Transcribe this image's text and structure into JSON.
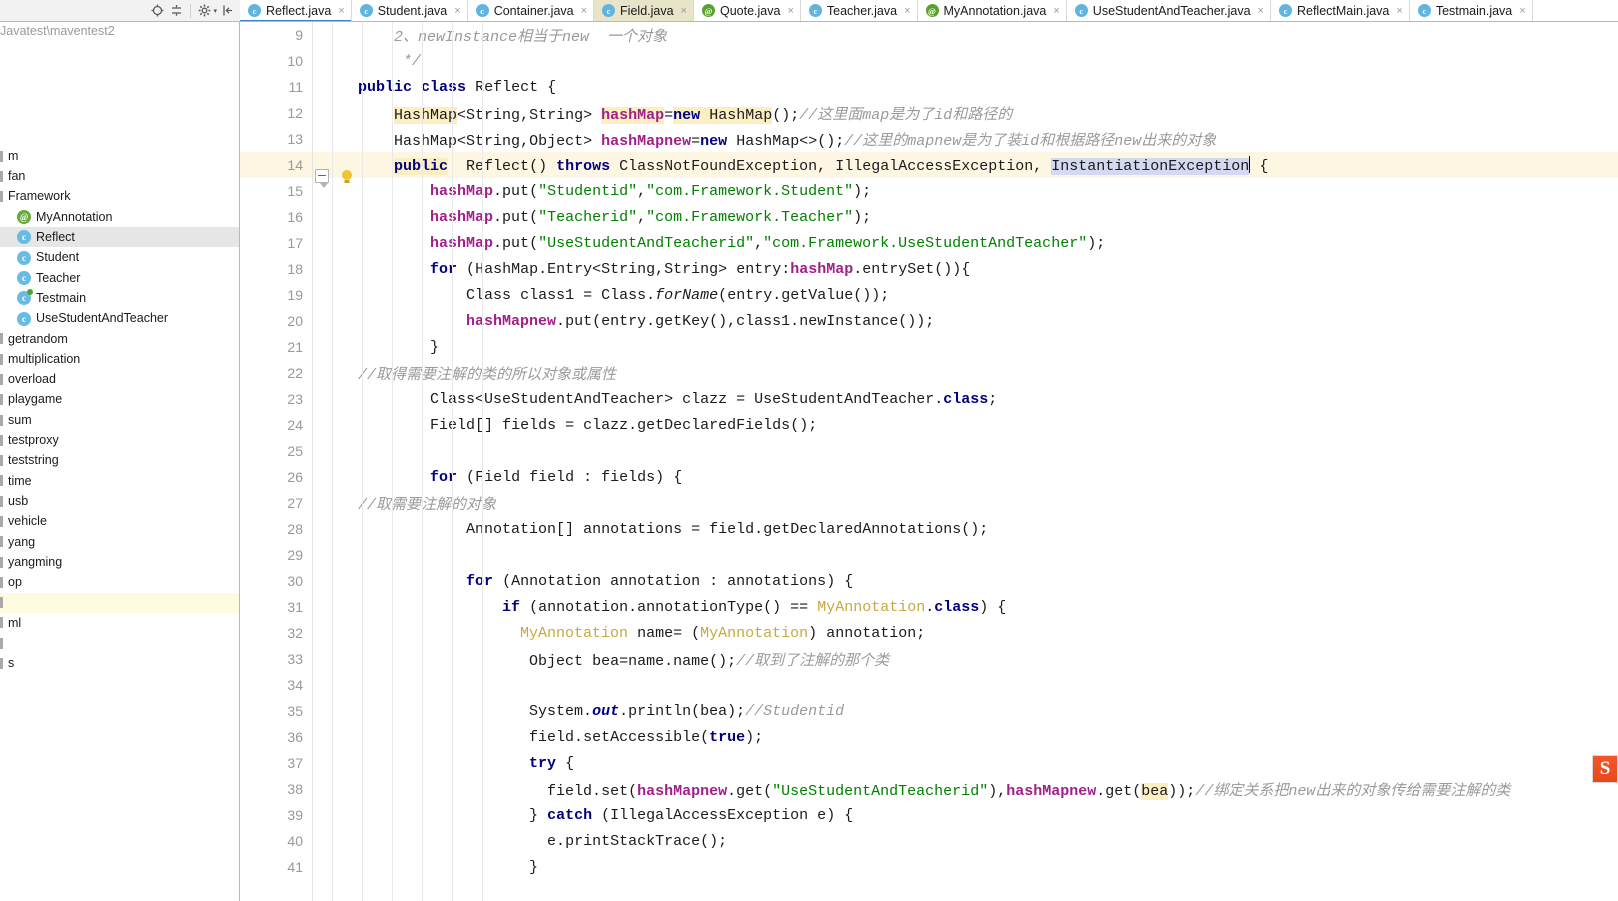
{
  "project_toolbar": {
    "icons": [
      {
        "name": "locate-target-icon",
        "title": "Select Opened File"
      },
      {
        "name": "collapse-all-icon",
        "title": "Collapse All"
      },
      {
        "name": "gear-icon",
        "title": "Settings"
      },
      {
        "name": "hide-panel-icon",
        "title": "Hide"
      }
    ]
  },
  "tabs": [
    {
      "label": "Reflect.java",
      "icon": "class-icon",
      "active": true,
      "tinted": false
    },
    {
      "label": "Student.java",
      "icon": "class-icon",
      "active": false,
      "tinted": false
    },
    {
      "label": "Container.java",
      "icon": "class-icon",
      "active": false,
      "tinted": false
    },
    {
      "label": "Field.java",
      "icon": "class-icon",
      "active": false,
      "tinted": true
    },
    {
      "label": "Quote.java",
      "icon": "annotation-icon",
      "active": false,
      "tinted": false
    },
    {
      "label": "Teacher.java",
      "icon": "class-icon",
      "active": false,
      "tinted": false
    },
    {
      "label": "MyAnnotation.java",
      "icon": "annotation-icon",
      "active": false,
      "tinted": false
    },
    {
      "label": "UseStudentAndTeacher.java",
      "icon": "class-icon",
      "active": false,
      "tinted": false
    },
    {
      "label": "ReflectMain.java",
      "icon": "class-icon",
      "active": false,
      "tinted": false
    },
    {
      "label": "Testmain.java",
      "icon": "class-icon",
      "active": false,
      "tinted": false
    }
  ],
  "close_glyph": "×",
  "project_tree": {
    "path_label": "Javatest\\maventest2",
    "items": [
      {
        "label": "m",
        "kind": "package-truncated",
        "indent": 0,
        "selected": false,
        "highlighted": false
      },
      {
        "label": "fan",
        "kind": "package",
        "indent": 0,
        "selected": false,
        "highlighted": false
      },
      {
        "label": "Framework",
        "kind": "package",
        "indent": 0,
        "selected": false,
        "highlighted": false
      },
      {
        "label": "MyAnnotation",
        "kind": "annotation",
        "indent": 1,
        "selected": false,
        "highlighted": false
      },
      {
        "label": "Reflect",
        "kind": "class",
        "indent": 1,
        "selected": true,
        "highlighted": false
      },
      {
        "label": "Student",
        "kind": "class",
        "indent": 1,
        "selected": false,
        "highlighted": false
      },
      {
        "label": "Teacher",
        "kind": "class",
        "indent": 1,
        "selected": false,
        "highlighted": false
      },
      {
        "label": "Testmain",
        "kind": "runnable-class",
        "indent": 1,
        "selected": false,
        "highlighted": false
      },
      {
        "label": "UseStudentAndTeacher",
        "kind": "class",
        "indent": 1,
        "selected": false,
        "highlighted": false
      },
      {
        "label": "getrandom",
        "kind": "package",
        "indent": 0,
        "selected": false,
        "highlighted": false
      },
      {
        "label": "multiplication",
        "kind": "package",
        "indent": 0,
        "selected": false,
        "highlighted": false
      },
      {
        "label": "overload",
        "kind": "package",
        "indent": 0,
        "selected": false,
        "highlighted": false
      },
      {
        "label": "playgame",
        "kind": "package",
        "indent": 0,
        "selected": false,
        "highlighted": false
      },
      {
        "label": "sum",
        "kind": "package",
        "indent": 0,
        "selected": false,
        "highlighted": false
      },
      {
        "label": "testproxy",
        "kind": "package",
        "indent": 0,
        "selected": false,
        "highlighted": false
      },
      {
        "label": "teststring",
        "kind": "package",
        "indent": 0,
        "selected": false,
        "highlighted": false
      },
      {
        "label": "time",
        "kind": "package",
        "indent": 0,
        "selected": false,
        "highlighted": false
      },
      {
        "label": "usb",
        "kind": "package",
        "indent": 0,
        "selected": false,
        "highlighted": false
      },
      {
        "label": "vehicle",
        "kind": "package",
        "indent": 0,
        "selected": false,
        "highlighted": false
      },
      {
        "label": "yang",
        "kind": "package",
        "indent": 0,
        "selected": false,
        "highlighted": false
      },
      {
        "label": "yangming",
        "kind": "package",
        "indent": 0,
        "selected": false,
        "highlighted": false
      },
      {
        "label": "op",
        "kind": "truncated",
        "indent": 0,
        "selected": false,
        "highlighted": false
      },
      {
        "label": "",
        "kind": "truncated",
        "indent": 0,
        "selected": false,
        "highlighted": true
      },
      {
        "label": "ml",
        "kind": "truncated",
        "indent": 0,
        "selected": false,
        "highlighted": false
      },
      {
        "label": "",
        "kind": "blank",
        "indent": 0,
        "selected": false,
        "highlighted": false
      },
      {
        "label": "s",
        "kind": "truncated",
        "indent": 0,
        "selected": false,
        "highlighted": false
      }
    ]
  },
  "editor": {
    "file": "Reflect.java",
    "first_visible_line": 9,
    "current_line": 14,
    "caret_after": "InstantiationException",
    "gutter_icons": {
      "fold": "fold-collapse-icon",
      "intention": "lightbulb-icon"
    },
    "lines": [
      {
        "n": 9,
        "text": "    2、newInstance相当于new  一个对象"
      },
      {
        "n": 10,
        "text": "     */"
      },
      {
        "n": 11,
        "text": "public class Reflect {"
      },
      {
        "n": 12,
        "text": "    HashMap<String,String> hashMap=new HashMap();//这里面map是为了id和路径的"
      },
      {
        "n": 13,
        "text": "    HashMap<String,Object> hashMapnew=new HashMap<>();//这里的mapnew是为了装id和根据路径new出来的对象"
      },
      {
        "n": 14,
        "text": "    public  Reflect() throws ClassNotFoundException, IllegalAccessException, InstantiationException {"
      },
      {
        "n": 15,
        "text": "        hashMap.put(\"Studentid\",\"com.Framework.Student\");"
      },
      {
        "n": 16,
        "text": "        hashMap.put(\"Teacherid\",\"com.Framework.Teacher\");"
      },
      {
        "n": 17,
        "text": "        hashMap.put(\"UseStudentAndTeacherid\",\"com.Framework.UseStudentAndTeacher\");"
      },
      {
        "n": 18,
        "text": "        for (HashMap.Entry<String,String> entry:hashMap.entrySet()){"
      },
      {
        "n": 19,
        "text": "            Class class1 = Class.forName(entry.getValue());"
      },
      {
        "n": 20,
        "text": "            hashMapnew.put(entry.getKey(),class1.newInstance());"
      },
      {
        "n": 21,
        "text": "        }"
      },
      {
        "n": 22,
        "text": "//取得需要注解的类的所以对象或属性"
      },
      {
        "n": 23,
        "text": "        Class<UseStudentAndTeacher> clazz = UseStudentAndTeacher.class;"
      },
      {
        "n": 24,
        "text": "        Field[] fields = clazz.getDeclaredFields();"
      },
      {
        "n": 25,
        "text": ""
      },
      {
        "n": 26,
        "text": "        for (Field field : fields) {"
      },
      {
        "n": 27,
        "text": "//取需要注解的对象"
      },
      {
        "n": 28,
        "text": "            Annotation[] annotations = field.getDeclaredAnnotations();"
      },
      {
        "n": 29,
        "text": ""
      },
      {
        "n": 30,
        "text": "            for (Annotation annotation : annotations) {"
      },
      {
        "n": 31,
        "text": "                if (annotation.annotationType() == MyAnnotation.class) {"
      },
      {
        "n": 32,
        "text": "                  MyAnnotation name= (MyAnnotation) annotation;"
      },
      {
        "n": 33,
        "text": "                   Object bea=name.name();//取到了注解的那个类"
      },
      {
        "n": 34,
        "text": ""
      },
      {
        "n": 35,
        "text": "                   System.out.println(bea);//Studentid"
      },
      {
        "n": 36,
        "text": "                   field.setAccessible(true);"
      },
      {
        "n": 37,
        "text": "                   try {"
      },
      {
        "n": 38,
        "text": "                     field.set(hashMapnew.get(\"UseStudentAndTeacherid\"),hashMapnew.get(bea));//绑定关系把new出来的对象传给需要注解的类"
      },
      {
        "n": 39,
        "text": "                   } catch (IllegalAccessException e) {"
      },
      {
        "n": 40,
        "text": "                     e.printStackTrace();"
      },
      {
        "n": 41,
        "text": "                   }"
      }
    ]
  },
  "right_badge": {
    "label": "S",
    "name": "sogou-ime-badge"
  },
  "colors": {
    "keyword": "#000080",
    "string": "#008000",
    "comment": "#9a9a9a",
    "field": "#a0208a",
    "annotation": "#c6a93f",
    "selection": "#d4d8f0",
    "identifier_highlight": "#fbeec0",
    "current_line": "#fdf6e3",
    "tab_underline": "#4181c6"
  }
}
